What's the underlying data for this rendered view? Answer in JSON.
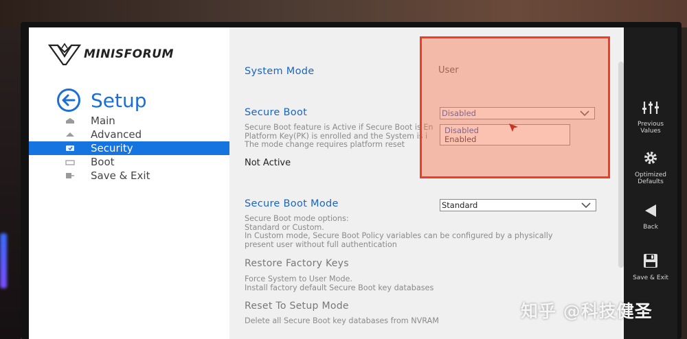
{
  "brand": {
    "name": "MINISFORUM"
  },
  "setup": {
    "title": "Setup"
  },
  "nav": {
    "items": [
      {
        "label": "Main"
      },
      {
        "label": "Advanced"
      },
      {
        "label": "Security"
      },
      {
        "label": "Boot"
      },
      {
        "label": "Save & Exit"
      }
    ]
  },
  "system_mode": {
    "label": "System Mode",
    "value": "User"
  },
  "secure_boot": {
    "label": "Secure Boot",
    "description": [
      "Secure Boot feature is Active if Secure Boot is En",
      "Platform Key(PK) is enrolled and the System is i",
      "The mode change requires platform reset"
    ],
    "status": "Not Active",
    "selected": "Disabled",
    "options": [
      "Disabled",
      "Enabled"
    ]
  },
  "secure_boot_mode": {
    "label": "Secure Boot Mode",
    "selected": "Standard",
    "description": [
      "Secure Boot mode options:",
      "Standard or Custom.",
      "In Custom mode, Secure Boot Policy variables can be configured by a physically",
      "present user without full authentication"
    ]
  },
  "restore_factory_keys": {
    "label": "Restore Factory Keys",
    "description": [
      "Force System to User Mode.",
      "Install factory default Secure Boot key databases"
    ]
  },
  "reset_setup_mode": {
    "label": "Reset To Setup Mode",
    "description": [
      "Delete all Secure Boot key databases from NVRAM"
    ]
  },
  "rail": {
    "previous_values": "Previous Values",
    "optimized_defaults": "Optimized Defaults",
    "back": "Back",
    "save_exit": "Save & Exit"
  },
  "watermark": "知乎 @科技健圣",
  "colors": {
    "accent": "#1674e0",
    "heading": "#1a64c4",
    "highlight_border": "#f23b22",
    "rail": "#1c1c1c"
  }
}
